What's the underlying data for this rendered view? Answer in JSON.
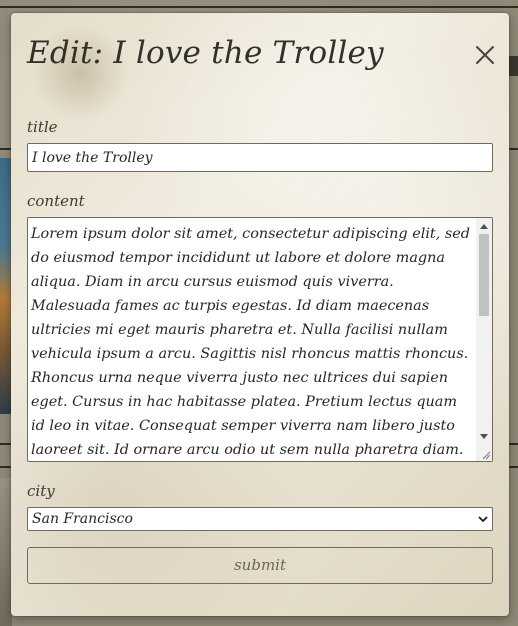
{
  "modal": {
    "title": "Edit: I love the Trolley",
    "close_icon": "close-icon"
  },
  "form": {
    "title_label": "title",
    "title_value": "I love the Trolley",
    "content_label": "content",
    "content_value": "Lorem ipsum dolor sit amet, consectetur adipiscing elit, sed do eiusmod tempor incididunt ut labore et dolore magna aliqua. Diam in arcu cursus euismod quis viverra. Malesuada fames ac turpis egestas. Id diam maecenas ultricies mi eget mauris pharetra et. Nulla facilisi nullam vehicula ipsum a arcu. Sagittis nisl rhoncus mattis rhoncus. Rhoncus urna neque viverra justo nec ultrices dui sapien eget. Cursus in hac habitasse platea. Pretium lectus quam id leo in vitae. Consequat semper viverra nam libero justo laoreet sit. Id ornare arcu odio ut sem nulla pharetra diam.",
    "city_label": "city",
    "city_selected": "San Francisco",
    "submit_label": "submit"
  },
  "colors": {
    "modal_background": "#ece6d6",
    "text": "#33302b",
    "input_border": "#6f6b63"
  }
}
